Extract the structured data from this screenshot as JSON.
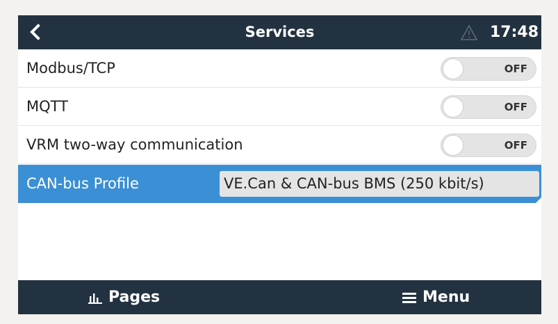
{
  "header": {
    "back_icon": "chevron-left-icon",
    "title": "Services",
    "warning_icon": "warning-triangle-icon",
    "time": "17:48"
  },
  "rows": [
    {
      "label": "Modbus/TCP",
      "toggle_state": "OFF"
    },
    {
      "label": "MQTT",
      "toggle_state": "OFF"
    },
    {
      "label": "VRM two-way communication",
      "toggle_state": "OFF"
    }
  ],
  "can_bus": {
    "label": "CAN-bus Profile",
    "value": "VE.Can & CAN-bus BMS (250 kbit/s)"
  },
  "footer": {
    "pages_icon": "bar-chart-icon",
    "pages_label": "Pages",
    "menu_icon": "hamburger-menu-icon",
    "menu_label": "Menu"
  },
  "colors": {
    "header_bg": "#233240",
    "selected_bg": "#3b8fd4",
    "toggle_bg": "#e4e4e4"
  }
}
